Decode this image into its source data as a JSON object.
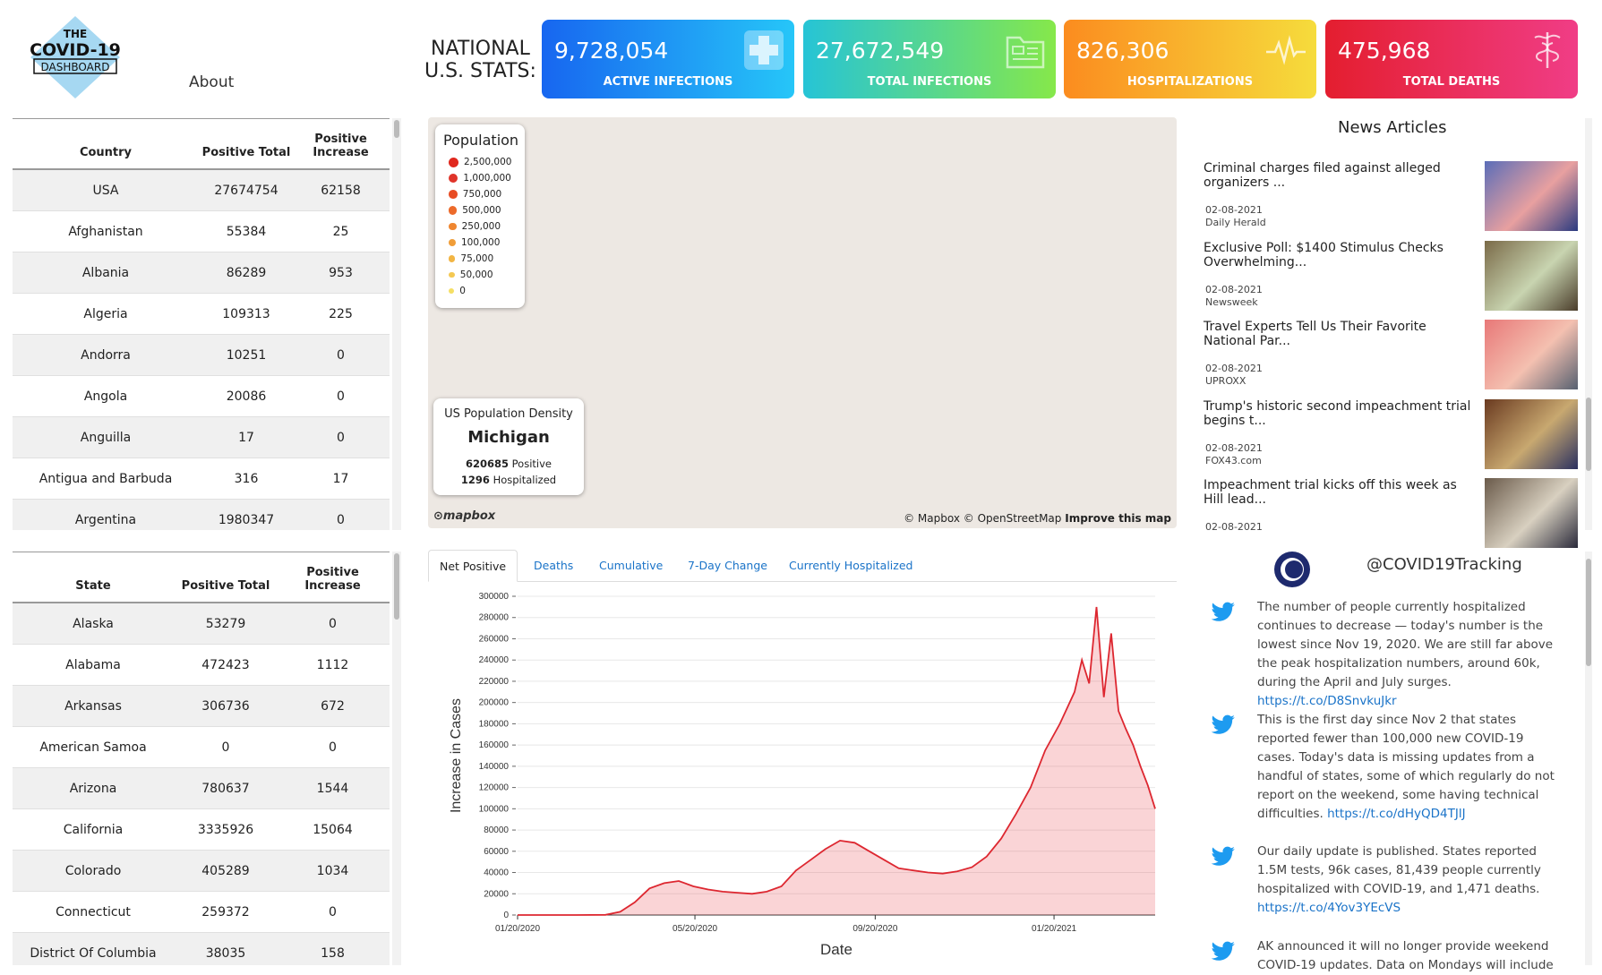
{
  "app": {
    "logo_line1": "THE",
    "logo_line2": "COVID-19",
    "logo_line3": "DASHBOARD",
    "about": "About",
    "national": "NATIONAL",
    "us_stats": "U.S. STATS:"
  },
  "stats": [
    {
      "value": "9,728,054",
      "label": "ACTIVE INFECTIONS",
      "icon": "medical-cross-icon"
    },
    {
      "value": "27,672,549",
      "label": "TOTAL INFECTIONS",
      "icon": "folder-chart-icon"
    },
    {
      "value": "826,306",
      "label": "HOSPITALIZATIONS",
      "icon": "heartbeat-icon"
    },
    {
      "value": "475,968",
      "label": "TOTAL DEATHS",
      "icon": "caduceus-icon"
    }
  ],
  "countries": {
    "headers": [
      "Country",
      "Positive Total",
      "Positive Increase"
    ],
    "rows": [
      [
        "USA",
        "27674754",
        "62158"
      ],
      [
        "Afghanistan",
        "55384",
        "25"
      ],
      [
        "Albania",
        "86289",
        "953"
      ],
      [
        "Algeria",
        "109313",
        "225"
      ],
      [
        "Andorra",
        "10251",
        "0"
      ],
      [
        "Angola",
        "20086",
        "0"
      ],
      [
        "Anguilla",
        "17",
        "0"
      ],
      [
        "Antigua and Barbuda",
        "316",
        "17"
      ],
      [
        "Argentina",
        "1980347",
        "0"
      ]
    ]
  },
  "states": {
    "headers": [
      "State",
      "Positive Total",
      "Positive Increase"
    ],
    "rows": [
      [
        "Alaska",
        "53279",
        "0"
      ],
      [
        "Alabama",
        "472423",
        "1112"
      ],
      [
        "Arkansas",
        "306736",
        "672"
      ],
      [
        "American Samoa",
        "0",
        "0"
      ],
      [
        "Arizona",
        "780637",
        "1544"
      ],
      [
        "California",
        "3335926",
        "15064"
      ],
      [
        "Colorado",
        "405289",
        "1034"
      ],
      [
        "Connecticut",
        "259372",
        "0"
      ],
      [
        "District Of Columbia",
        "38035",
        "158"
      ]
    ]
  },
  "map": {
    "legend_title": "Population",
    "legend": [
      {
        "label": "2,500,000",
        "color": "#e0281e"
      },
      {
        "label": "1,000,000",
        "color": "#e0342a"
      },
      {
        "label": "750,000",
        "color": "#e84c24"
      },
      {
        "label": "500,000",
        "color": "#ec6a2a"
      },
      {
        "label": "250,000",
        "color": "#ef8630"
      },
      {
        "label": "100,000",
        "color": "#f09d38"
      },
      {
        "label": "75,000",
        "color": "#f2b544"
      },
      {
        "label": "50,000",
        "color": "#f4c852"
      },
      {
        "label": "0",
        "color": "#f5df64"
      }
    ],
    "density_title": "US Population Density",
    "state": "Michigan",
    "positive_num": "620685",
    "positive_lbl": "Positive",
    "hosp_num": "1296",
    "hosp_lbl": "Hospitalized",
    "mapbox": "mapbox",
    "attribution": "© Mapbox © OpenStreetMap",
    "improve": "Improve this map"
  },
  "news": {
    "title": "News Articles",
    "articles": [
      {
        "title": "Criminal charges filed against alleged organizers ...",
        "date": "02-08-2021",
        "source": "Daily Herald"
      },
      {
        "title": "Exclusive Poll: $1400 Stimulus Checks Overwhelming...",
        "date": "02-08-2021",
        "source": "Newsweek"
      },
      {
        "title": "Travel Experts Tell Us Their Favorite National Par...",
        "date": "02-08-2021",
        "source": "UPROXX"
      },
      {
        "title": "Trump's historic second impeachment trial begins t...",
        "date": "02-08-2021",
        "source": "FOX43.com"
      },
      {
        "title": "Impeachment trial kicks off this week as Hill lead...",
        "date": "02-08-2021",
        "source": ""
      }
    ]
  },
  "tabs": [
    "Net Positive",
    "Deaths",
    "Cumulative",
    "7-Day Change",
    "Currently Hospitalized"
  ],
  "chart_data": {
    "type": "area",
    "ylabel": "Increase in Cases",
    "xlabel": "Date",
    "ylim": [
      0,
      300000
    ],
    "yticks": [
      "0",
      "20000",
      "40000",
      "60000",
      "80000",
      "100000",
      "120000",
      "140000",
      "160000",
      "180000",
      "200000",
      "220000",
      "240000",
      "260000",
      "280000",
      "300000"
    ],
    "xticks": [
      "01/20/2020",
      "05/20/2020",
      "09/20/2020",
      "01/20/2021"
    ],
    "series": [
      {
        "values": [
          [
            0,
            0
          ],
          [
            20,
            0
          ],
          [
            40,
            0
          ],
          [
            60,
            200
          ],
          [
            70,
            3000
          ],
          [
            80,
            12000
          ],
          [
            90,
            25000
          ],
          [
            100,
            30000
          ],
          [
            110,
            32000
          ],
          [
            120,
            27000
          ],
          [
            130,
            24000
          ],
          [
            140,
            22000
          ],
          [
            150,
            21000
          ],
          [
            160,
            20000
          ],
          [
            170,
            22000
          ],
          [
            180,
            27000
          ],
          [
            190,
            42000
          ],
          [
            200,
            52000
          ],
          [
            210,
            62000
          ],
          [
            220,
            70000
          ],
          [
            230,
            68000
          ],
          [
            240,
            60000
          ],
          [
            250,
            52000
          ],
          [
            260,
            44000
          ],
          [
            270,
            42000
          ],
          [
            280,
            40000
          ],
          [
            290,
            39000
          ],
          [
            300,
            41000
          ],
          [
            310,
            45000
          ],
          [
            320,
            55000
          ],
          [
            330,
            72000
          ],
          [
            340,
            95000
          ],
          [
            350,
            120000
          ],
          [
            360,
            155000
          ],
          [
            370,
            180000
          ],
          [
            375,
            195000
          ],
          [
            380,
            210000
          ],
          [
            385,
            240000
          ],
          [
            390,
            218000
          ],
          [
            395,
            290000
          ],
          [
            400,
            205000
          ],
          [
            405,
            265000
          ],
          [
            410,
            192000
          ],
          [
            415,
            175000
          ],
          [
            420,
            160000
          ],
          [
            425,
            140000
          ],
          [
            430,
            122000
          ],
          [
            435,
            100000
          ]
        ]
      }
    ]
  },
  "twitter": {
    "handle": "@COVID19Tracking",
    "tweets": [
      {
        "text": "The number of people currently hospitalized continues to decrease — today's number is the lowest since Nov 19, 2020. We are still far above the peak hospitalization numbers, around 60k, during the April and July surges.",
        "link": "https://t.co/D8SnvkuJkr"
      },
      {
        "text": "This is the first day since Nov 2 that states reported fewer than 100,000 new COVID-19 cases. Today's data is missing updates from a handful of states, some of which regularly do not report on the weekend, some having technical difficulties.",
        "link": "https://t.co/dHyQD4TJlJ"
      },
      {
        "text": "Our daily update is published. States reported 1.5M tests, 96k cases, 81,439 people currently hospitalized with COVID-19, and 1,471 deaths.",
        "link": "https://t.co/4Yov3YEcVS"
      },
      {
        "text": "AK announced it will no longer provide weekend COVID-19 updates. Data on Mondays will include",
        "link": ""
      }
    ]
  }
}
